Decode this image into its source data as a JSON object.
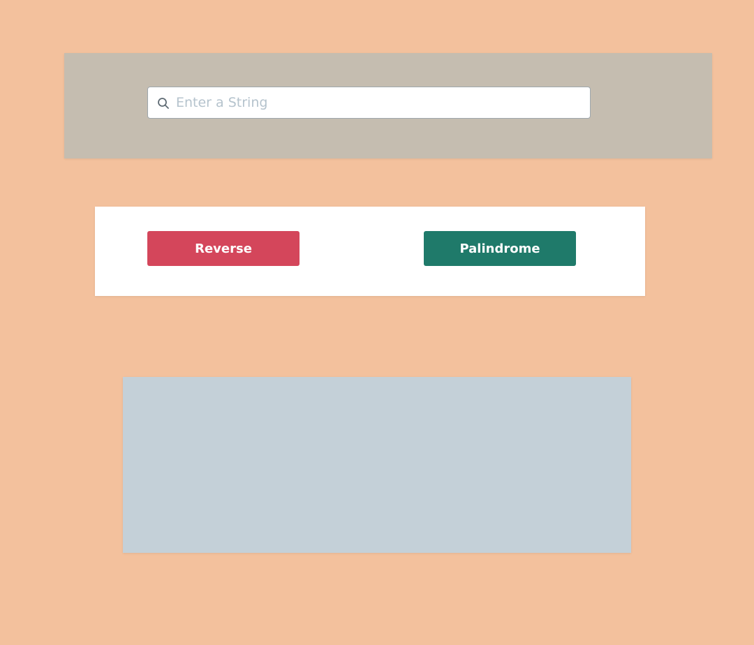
{
  "search": {
    "placeholder": "Enter a String",
    "value": "",
    "icon": "search-icon"
  },
  "actions": {
    "reverse_label": "Reverse",
    "palindrome_label": "Palindrome"
  },
  "result": {
    "text": ""
  },
  "colors": {
    "page_background": "#f3c19d",
    "search_panel": "#c5bdb0",
    "reverse_button": "#d4465b",
    "palindrome_button": "#1f7a6a",
    "result_panel": "#c4d0d8"
  }
}
